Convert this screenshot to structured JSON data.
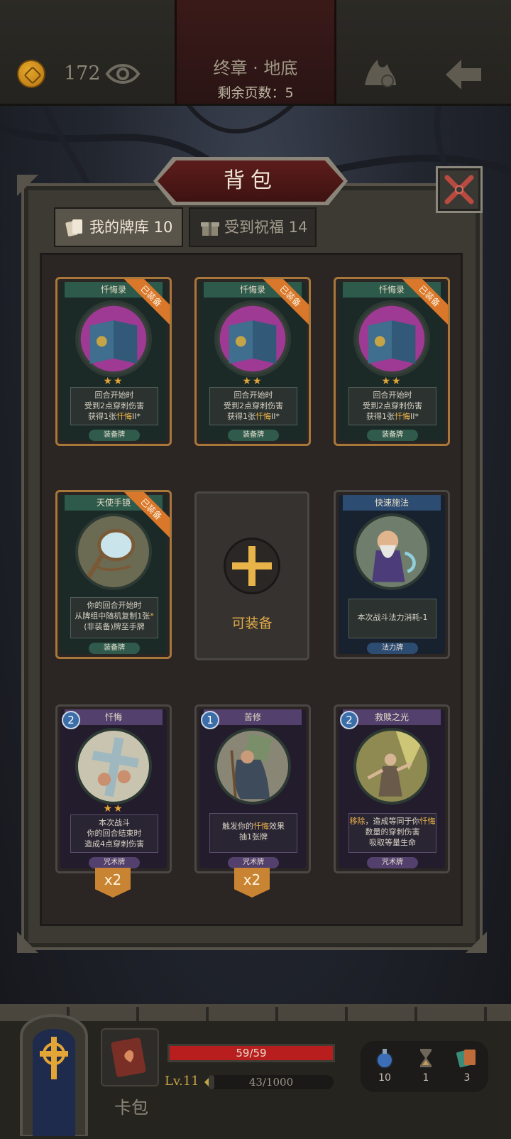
{
  "topbar": {
    "coins": "172",
    "chapter_title": "终章 · 地底",
    "pages_left": "剩余页数：5"
  },
  "panel": {
    "title": "背包",
    "tabs": [
      {
        "label": "我的牌库 10"
      },
      {
        "label": "受到祝福 14"
      }
    ]
  },
  "cards": [
    {
      "name": "忏悔录",
      "ribbon": "已装备",
      "stars": "★★",
      "desc_lines": [
        "回合开始时",
        "受到2点穿刺伤害"
      ],
      "desc_pre": "获得1张",
      "desc_hl": "忏悔",
      "desc_post": "II*",
      "type": "装备牌"
    },
    {
      "name": "忏悔录",
      "ribbon": "已装备",
      "stars": "★★",
      "desc_lines": [
        "回合开始时",
        "受到2点穿刺伤害"
      ],
      "desc_pre": "获得1张",
      "desc_hl": "忏悔",
      "desc_post": "II*",
      "type": "装备牌"
    },
    {
      "name": "忏悔录",
      "ribbon": "已装备",
      "stars": "★★",
      "desc_lines": [
        "回合开始时",
        "受到2点穿刺伤害"
      ],
      "desc_pre": "获得1张",
      "desc_hl": "忏悔",
      "desc_post": "II*",
      "type": "装备牌"
    },
    {
      "name": "天使手镜",
      "ribbon": "已装备",
      "desc1": "你的回合开始时",
      "desc2": "从牌组中随机复制1张",
      "desc2_star": "*",
      "desc3": "(非装备)牌至手牌",
      "type": "装备牌"
    },
    {
      "name": "快速施法",
      "desc1": "本次战斗法力消耗-1",
      "type": "法力牌"
    },
    {
      "name": "忏悔",
      "cost": "2",
      "stars": "★★",
      "desc1": "本次战斗",
      "desc2": "你的回合结束时",
      "desc3": "造成4点穿刺伤害",
      "type": "咒术牌",
      "count": "x2"
    },
    {
      "name": "苦修",
      "cost": "1",
      "desc_pre": "触发你的",
      "desc_hl": "忏悔",
      "desc_post": "效果",
      "desc2": "抽1张牌",
      "type": "咒术牌",
      "count": "x2"
    },
    {
      "name": "救赎之光",
      "cost": "2",
      "desc_hl": "移除",
      "desc_pre": "，造成等同于你",
      "desc_hl2": "忏悔",
      "desc2": "数量的穿刺伤害",
      "desc3": "吸取等量生命",
      "type": "咒术牌"
    }
  ],
  "empty_slot": {
    "label": "可装备"
  },
  "hud": {
    "cardbag_label": "卡包",
    "hp_text": "59/59",
    "hp_fraction": 1.0,
    "level": "Lv.11",
    "xp_text": "43/1000",
    "xp_fraction": 0.043,
    "resources": [
      {
        "icon": "potion-icon",
        "count": "10"
      },
      {
        "icon": "hourglass-icon",
        "count": "1"
      },
      {
        "icon": "cards-icon",
        "count": "3"
      }
    ]
  }
}
